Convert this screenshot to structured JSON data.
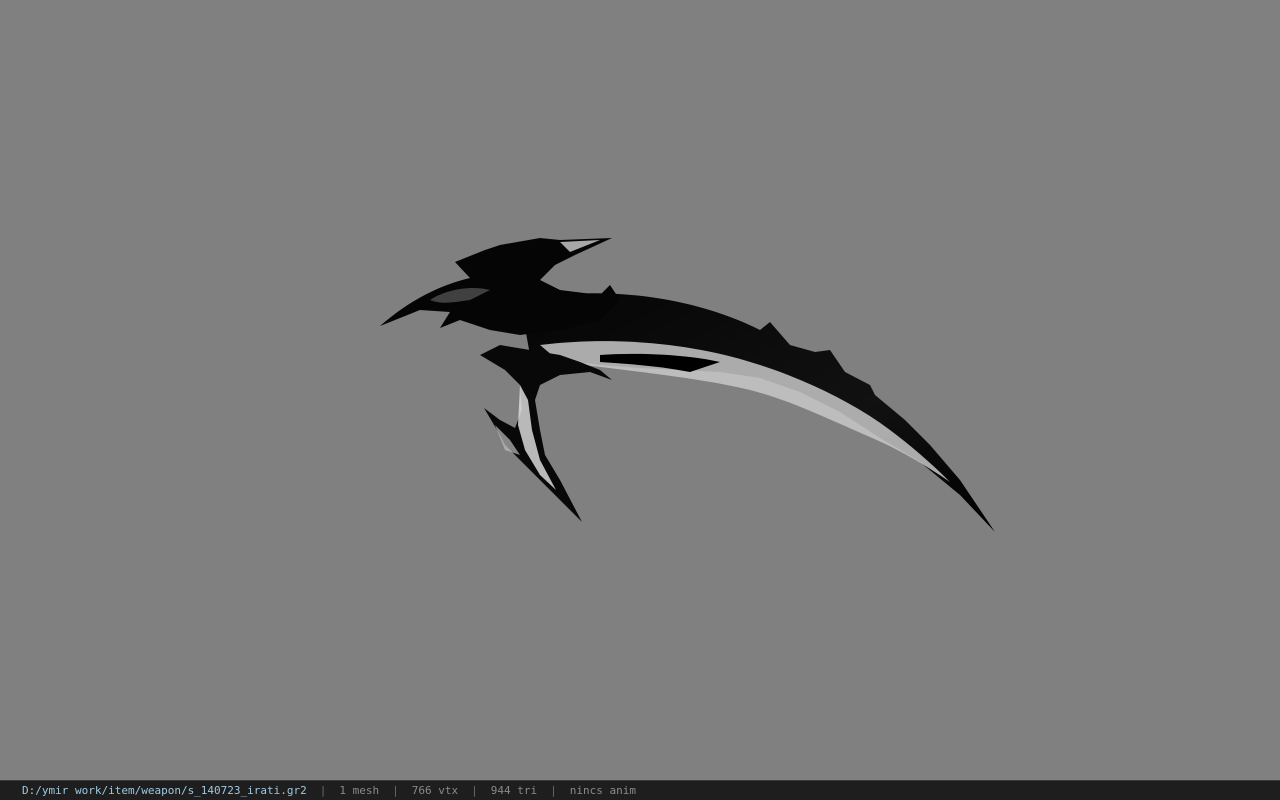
{
  "viewport": {
    "background_color": "#808080",
    "model_name": "weapon-model"
  },
  "status_bar": {
    "file_path": "D:/ymir work/item/weapon/s_140723_irati.gr2",
    "separator": "|",
    "mesh_count": "1 mesh",
    "vertex_count": "766 vtx",
    "triangle_count": "944 tri",
    "animation": "nincs anim"
  }
}
